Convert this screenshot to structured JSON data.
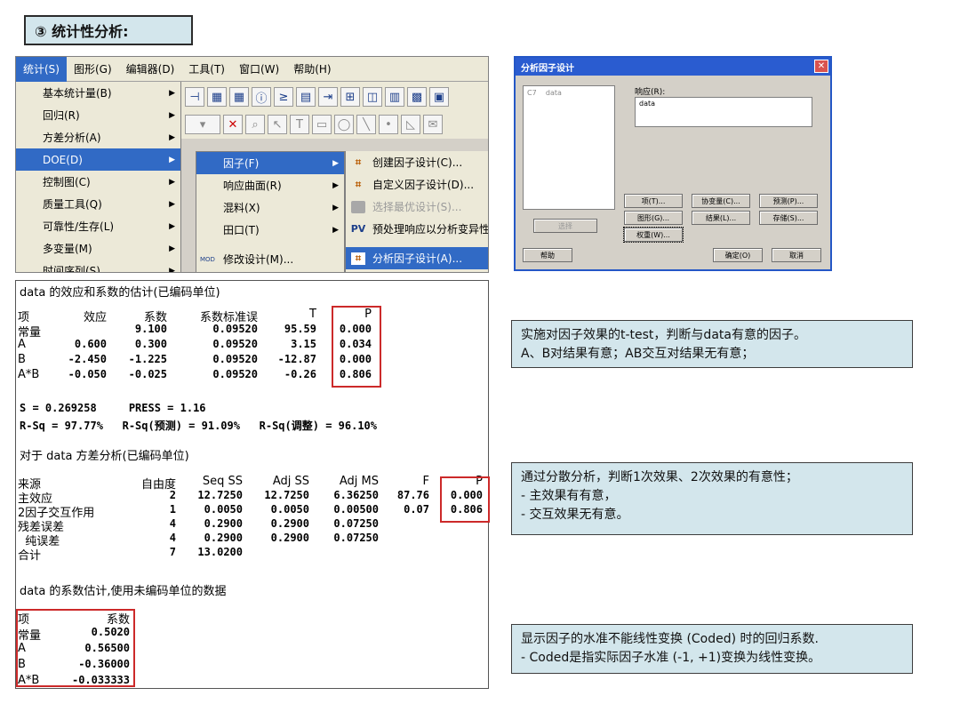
{
  "title": "③ 统计性分析:",
  "menubar": [
    "统计(S)",
    "图形(G)",
    "编辑器(D)",
    "工具(T)",
    "窗口(W)",
    "帮助(H)"
  ],
  "stat_menu": [
    "基本统计量(B)",
    "回归(R)",
    "方差分析(A)",
    "DOE(D)",
    "控制图(C)",
    "质量工具(Q)",
    "可靠性/生存(L)",
    "多变量(M)",
    "时间序列(S)"
  ],
  "doe_menu": [
    "因子(F)",
    "响应曲面(R)",
    "混料(X)",
    "田口(T)",
    "修改设计(M)..."
  ],
  "factor_menu": {
    "items": [
      "创建因子设计(C)...",
      "自定义因子设计(D)...",
      "选择最优设计(S)...",
      "预处理响应以分析变异性",
      "分析因子设计(A)..."
    ],
    "icons": [
      "factor-icon",
      "factor-icon",
      "gray-icon",
      "pv-icon",
      "factor-icon"
    ],
    "pv": "PV"
  },
  "modify_icon_label": "MOD",
  "dialog": {
    "title": "分析因子设计",
    "list_col": "C7",
    "list_var": "data",
    "response_label": "响应(R):",
    "response_value": "data",
    "buttons": {
      "terms": "项(T)...",
      "covariates": "协变量(C)...",
      "prediction": "预测(P)...",
      "graphs": "图形(G)...",
      "results": "结果(L)...",
      "storage": "存储(S)...",
      "weights": "权重(W)...",
      "select": "选择",
      "help": "帮助",
      "ok": "确定(O)",
      "cancel": "取消"
    }
  },
  "output": {
    "heading1": "data 的效应和系数的估计(已编码单位)",
    "coef_header": [
      "项",
      "效应",
      "系数",
      "系数标准误",
      "T",
      "P"
    ],
    "coef_rows": [
      [
        "常量",
        "",
        "9.100",
        "0.09520",
        "95.59",
        "0.000"
      ],
      [
        "A",
        "0.600",
        "0.300",
        "0.09520",
        "3.15",
        "0.034"
      ],
      [
        "B",
        "-2.450",
        "-1.225",
        "0.09520",
        "-12.87",
        "0.000"
      ],
      [
        "A*B",
        "-0.050",
        "-0.025",
        "0.09520",
        "-0.26",
        "0.806"
      ]
    ],
    "s_line": "S = 0.269258     PRESS = 1.16",
    "rsq_line": "R-Sq = 97.77%   R-Sq(预测) = 91.09%   R-Sq(调整) = 96.10%",
    "heading2": "对于 data 方差分析(已编码单位)",
    "anova_header": [
      "来源",
      "自由度",
      "Seq SS",
      "Adj SS",
      "Adj MS",
      "F",
      "P"
    ],
    "anova_rows": [
      [
        "主效应",
        "2",
        "12.7250",
        "12.7250",
        "6.36250",
        "87.76",
        "0.000"
      ],
      [
        "2因子交互作用",
        "1",
        "0.0050",
        "0.0050",
        "0.00500",
        "0.07",
        "0.806"
      ],
      [
        "残差误差",
        "4",
        "0.2900",
        "0.2900",
        "0.07250",
        "",
        ""
      ],
      [
        "  纯误差",
        "4",
        "0.2900",
        "0.2900",
        "0.07250",
        "",
        ""
      ],
      [
        "合计",
        "7",
        "13.0200",
        "",
        "",
        "",
        ""
      ]
    ],
    "heading3": "data 的系数估计,使用未编码单位的数据",
    "uncoded_header": [
      "项",
      "系数"
    ],
    "uncoded_rows": [
      [
        "常量",
        "0.5020"
      ],
      [
        "A",
        "0.56500"
      ],
      [
        "B",
        "-0.36000"
      ],
      [
        "A*B",
        "-0.033333"
      ]
    ]
  },
  "notes": [
    [
      "实施对因子效果的t-test，判断与data有意的因子。",
      "A、B对结果有意；AB交互对结果无有意；"
    ],
    [
      "通过分散分析，判断1次效果、2次效果的有意性；",
      " - 主效果有有意，",
      " - 交互效果无有意。"
    ],
    [
      "显示因子的水准不能线性变换 (Coded)  时的回归系数.",
      " - Coded是指实际因子水准 (-1, +1)变换为线性变换。"
    ]
  ]
}
